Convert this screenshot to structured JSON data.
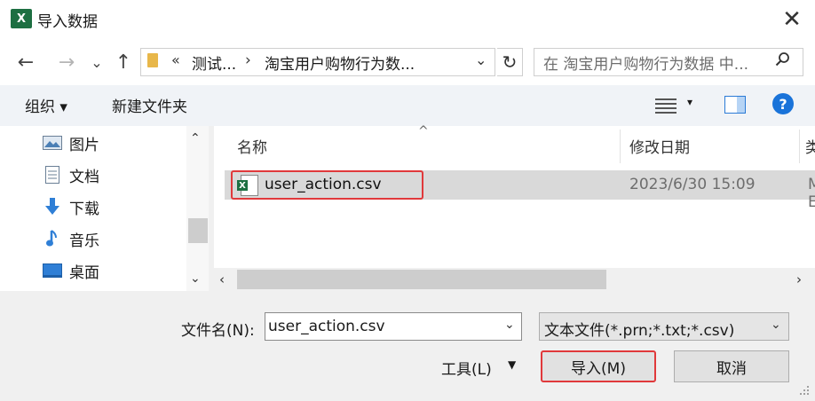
{
  "window": {
    "title": "导入数据",
    "app_icon_label": "X",
    "close_glyph": "✕"
  },
  "nav_buttons": {
    "back": "←",
    "forward": "→",
    "recent": "⌄",
    "up": "↑"
  },
  "address": {
    "overflow": "«",
    "segment1": "测试...",
    "separator": "›",
    "segment2": "淘宝用户购物行为数...",
    "dropdown": "⌄",
    "refresh": "↻"
  },
  "search": {
    "placeholder": "在 淘宝用户购物行为数据 中..."
  },
  "toolbar": {
    "organize": "组织 ▾",
    "new_folder": "新建文件夹",
    "view_dropdown": "▾",
    "help": "?"
  },
  "sidebar": {
    "items": [
      {
        "label": "图片",
        "icon": "pictures-icon"
      },
      {
        "label": "文档",
        "icon": "documents-icon"
      },
      {
        "label": "下载",
        "icon": "downloads-icon"
      },
      {
        "label": "音乐",
        "icon": "music-icon"
      },
      {
        "label": "桌面",
        "icon": "desktop-icon"
      }
    ],
    "scroll_up": "⌃",
    "scroll_down": "⌄"
  },
  "file_list": {
    "columns": {
      "name": "名称",
      "date": "修改日期",
      "type": "类型"
    },
    "sort_caret": "^",
    "files": [
      {
        "name": "user_action.csv",
        "date": "2023/6/30 15:09",
        "type": "Microsoft Excel"
      }
    ],
    "scroll_left": "‹",
    "scroll_right": "›"
  },
  "footer": {
    "filename_label": "文件名(N):",
    "filename_value": "user_action.csv",
    "filename_dd": "⌄",
    "filetype_value": "文本文件(*.prn;*.txt;*.csv)",
    "filetype_dd": "⌄",
    "tools_label": "工具(L)",
    "tools_dd": "▼",
    "import_label": "导入(M)",
    "cancel_label": "取消"
  },
  "colors": {
    "highlight": "#e0393b",
    "excel_green": "#1d6f42",
    "help_blue": "#1a73d9"
  }
}
